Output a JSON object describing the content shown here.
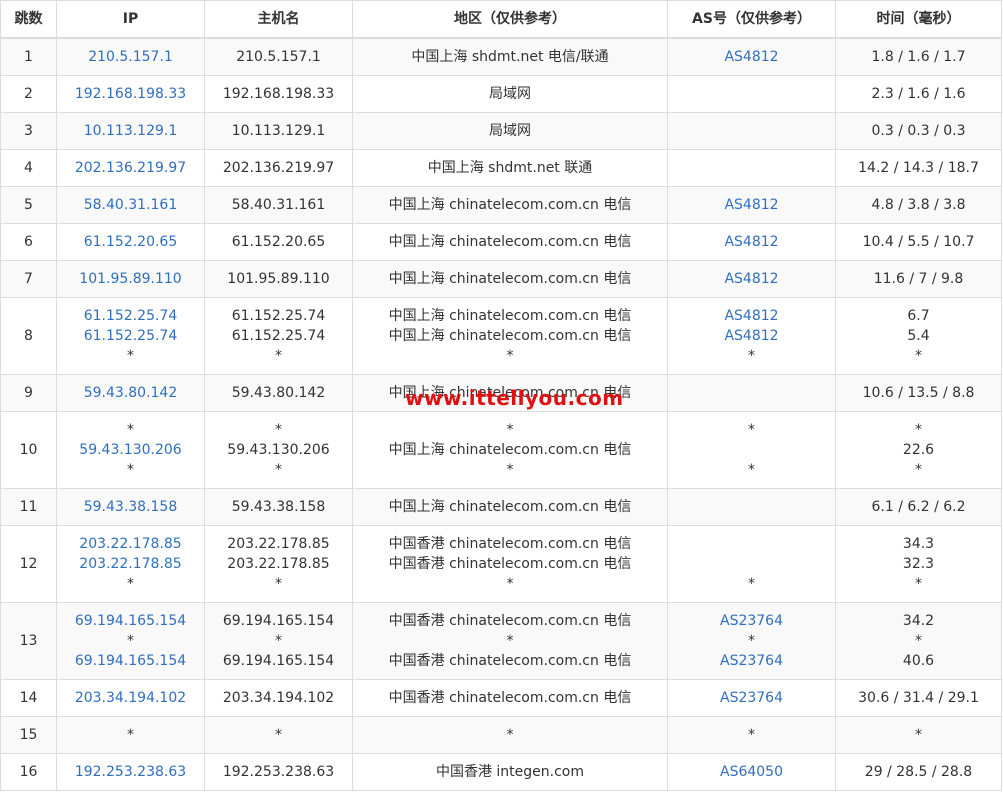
{
  "headers": [
    "跳数",
    "IP",
    "主机名",
    "地区（仅供参考）",
    "AS号（仅供参考）",
    "时间（毫秒）"
  ],
  "rows": [
    {
      "hop": "1",
      "ip": [
        "210.5.157.1"
      ],
      "host": [
        "210.5.157.1"
      ],
      "region": [
        "中国上海 shdmt.net 电信/联通"
      ],
      "as": [
        "AS4812"
      ],
      "time": [
        "1.8 / 1.6 / 1.7"
      ]
    },
    {
      "hop": "2",
      "ip": [
        "192.168.198.33"
      ],
      "host": [
        "192.168.198.33"
      ],
      "region": [
        "局域网"
      ],
      "as": [
        ""
      ],
      "time": [
        "2.3 / 1.6 / 1.6"
      ]
    },
    {
      "hop": "3",
      "ip": [
        "10.113.129.1"
      ],
      "host": [
        "10.113.129.1"
      ],
      "region": [
        "局域网"
      ],
      "as": [
        ""
      ],
      "time": [
        "0.3 / 0.3 / 0.3"
      ]
    },
    {
      "hop": "4",
      "ip": [
        "202.136.219.97"
      ],
      "host": [
        "202.136.219.97"
      ],
      "region": [
        "中国上海 shdmt.net 联通"
      ],
      "as": [
        ""
      ],
      "time": [
        "14.2 / 14.3 / 18.7"
      ]
    },
    {
      "hop": "5",
      "ip": [
        "58.40.31.161"
      ],
      "host": [
        "58.40.31.161"
      ],
      "region": [
        "中国上海 chinatelecom.com.cn 电信"
      ],
      "as": [
        "AS4812"
      ],
      "time": [
        "4.8 / 3.8 / 3.8"
      ]
    },
    {
      "hop": "6",
      "ip": [
        "61.152.20.65"
      ],
      "host": [
        "61.152.20.65"
      ],
      "region": [
        "中国上海 chinatelecom.com.cn 电信"
      ],
      "as": [
        "AS4812"
      ],
      "time": [
        "10.4 / 5.5 / 10.7"
      ]
    },
    {
      "hop": "7",
      "ip": [
        "101.95.89.110"
      ],
      "host": [
        "101.95.89.110"
      ],
      "region": [
        "中国上海 chinatelecom.com.cn 电信"
      ],
      "as": [
        "AS4812"
      ],
      "time": [
        "11.6 / 7 / 9.8"
      ]
    },
    {
      "hop": "8",
      "ip": [
        "61.152.25.74",
        "61.152.25.74",
        "*"
      ],
      "host": [
        "61.152.25.74",
        "61.152.25.74",
        "*"
      ],
      "region": [
        "中国上海 chinatelecom.com.cn 电信",
        "中国上海 chinatelecom.com.cn 电信",
        "*"
      ],
      "as": [
        "AS4812",
        "AS4812",
        "*"
      ],
      "time": [
        "6.7",
        "5.4",
        "*"
      ]
    },
    {
      "hop": "9",
      "ip": [
        "59.43.80.142"
      ],
      "host": [
        "59.43.80.142"
      ],
      "region": [
        "中国上海 chinatelecom.com.cn 电信"
      ],
      "as": [
        ""
      ],
      "time": [
        "10.6 / 13.5 / 8.8"
      ]
    },
    {
      "hop": "10",
      "ip": [
        "*",
        "59.43.130.206",
        "*"
      ],
      "host": [
        "*",
        "59.43.130.206",
        "*"
      ],
      "region": [
        "*",
        "中国上海 chinatelecom.com.cn 电信",
        "*"
      ],
      "as": [
        "*",
        "",
        "*"
      ],
      "time": [
        "*",
        "22.6",
        "*"
      ]
    },
    {
      "hop": "11",
      "ip": [
        "59.43.38.158"
      ],
      "host": [
        "59.43.38.158"
      ],
      "region": [
        "中国上海 chinatelecom.com.cn 电信"
      ],
      "as": [
        ""
      ],
      "time": [
        "6.1 / 6.2 / 6.2"
      ]
    },
    {
      "hop": "12",
      "ip": [
        "203.22.178.85",
        "203.22.178.85",
        "*"
      ],
      "host": [
        "203.22.178.85",
        "203.22.178.85",
        "*"
      ],
      "region": [
        "中国香港 chinatelecom.com.cn 电信",
        "中国香港 chinatelecom.com.cn 电信",
        "*"
      ],
      "as": [
        "",
        "",
        "*"
      ],
      "time": [
        "34.3",
        "32.3",
        "*"
      ]
    },
    {
      "hop": "13",
      "ip": [
        "69.194.165.154",
        "*",
        "69.194.165.154"
      ],
      "host": [
        "69.194.165.154",
        "*",
        "69.194.165.154"
      ],
      "region": [
        "中国香港 chinatelecom.com.cn 电信",
        "*",
        "中国香港 chinatelecom.com.cn 电信"
      ],
      "as": [
        "AS23764",
        "*",
        "AS23764"
      ],
      "time": [
        "34.2",
        "*",
        "40.6"
      ]
    },
    {
      "hop": "14",
      "ip": [
        "203.34.194.102"
      ],
      "host": [
        "203.34.194.102"
      ],
      "region": [
        "中国香港 chinatelecom.com.cn 电信"
      ],
      "as": [
        "AS23764"
      ],
      "time": [
        "30.6 / 31.4 / 29.1"
      ]
    },
    {
      "hop": "15",
      "ip": [
        "*"
      ],
      "host": [
        "*"
      ],
      "region": [
        "*"
      ],
      "as": [
        "*"
      ],
      "time": [
        "*"
      ]
    },
    {
      "hop": "16",
      "ip": [
        "192.253.238.63"
      ],
      "host": [
        "192.253.238.63"
      ],
      "region": [
        "中国香港 integen.com"
      ],
      "as": [
        "AS64050"
      ],
      "time": [
        "29 / 28.5 / 28.8"
      ]
    }
  ],
  "watermark": "www.ittellyou.com",
  "colors": {
    "link": "#2f6fbf",
    "watermark": "#e01010",
    "border": "#dddddd",
    "stripe": "#f9f9f9"
  }
}
